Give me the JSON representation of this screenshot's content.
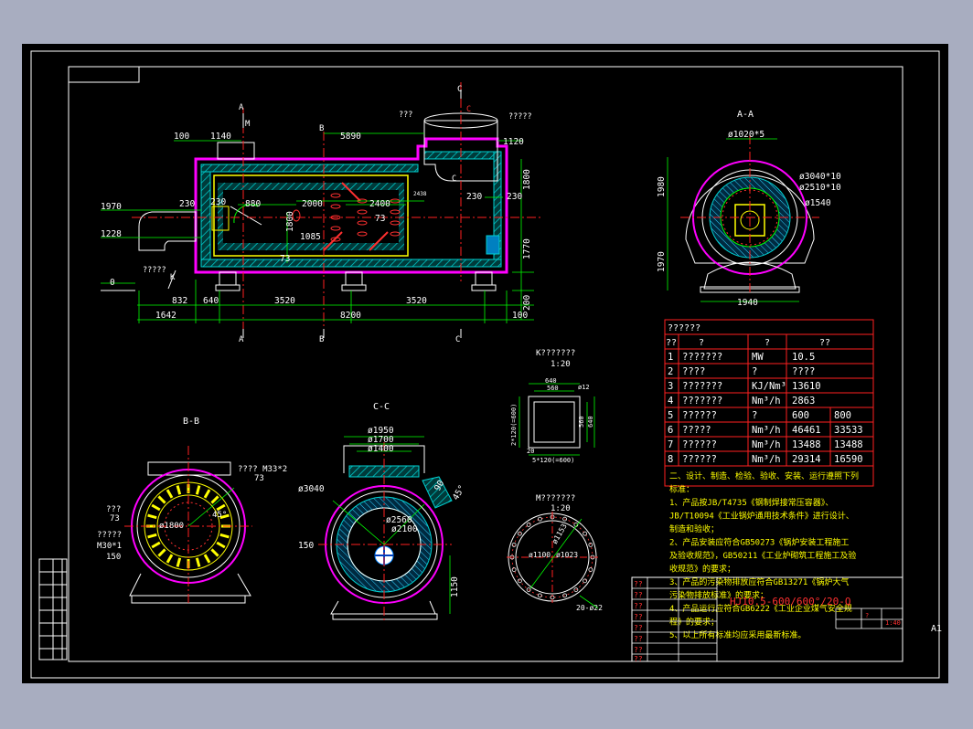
{
  "colors": {
    "background": "#000000",
    "frame": "#ffffff",
    "dimension": "#00ff00",
    "table": "#ff2020",
    "insulation": "#ff00ff",
    "hatch": "#00d0d0",
    "center": "#ff2020",
    "note_text": "#ffff00",
    "part_no": "#ff3030"
  },
  "sheet_label": "A1",
  "main_view": {
    "section_marks": [
      "A",
      "B",
      "C",
      "K",
      "M"
    ],
    "labels": {
      "top_q": "???",
      "top_qq": "?????",
      "top_c": "C",
      "left_q": "?????",
      "c_q": "????",
      "plate_q": "?",
      "hole_q": "?"
    },
    "dims": {
      "d100": "100",
      "d1140": "1140",
      "d5890": "5890",
      "d1120": "1120",
      "d230a": "230",
      "d230b": "230",
      "d230c": "230",
      "d880": "880",
      "d2000": "2000",
      "d2400": "2400",
      "d1800": "1800",
      "d1085": "1085",
      "d1800v": "1800",
      "d1770": "1770",
      "d1970": "1970",
      "d1228": "1228",
      "d0": "0",
      "d832": "832",
      "d640": "640",
      "d3520a": "3520",
      "d3520b": "3520",
      "d1642": "1642",
      "d8200": "8200",
      "d200": "200",
      "d100b": "100",
      "d2438": "2438",
      "d73a": "73",
      "d73b": "73"
    }
  },
  "view_aa": {
    "title": "A-A",
    "dims": {
      "dia1020": "ø1020*5",
      "dia3040": "ø3040*10",
      "dia2510": "ø2510*10",
      "dia1540": "ø1540",
      "h1980": "1980",
      "h1970": "1970",
      "w1940": "1940"
    }
  },
  "view_bb": {
    "title": "B-B",
    "labels": {
      "bolt": "???? M33*2",
      "q73": "73",
      "q3": "???",
      "q73b": "73",
      "q4": "?????",
      "m30": "M30*1",
      "d150": "150",
      "dia1800": "ø1800",
      "deg45": "45°"
    }
  },
  "view_cc": {
    "title": "C-C",
    "dims": {
      "dia1950": "ø1950",
      "dia1700": "ø1700",
      "dia1400": "ø1400",
      "dia3040": "ø3040",
      "dia2560": "ø2560",
      "dia2100": "ø2100",
      "d150": "150",
      "d1150": "1150",
      "deg45": "45°",
      "d90": "90"
    }
  },
  "view_k": {
    "title": "K???????",
    "scale": "1:20",
    "dims": {
      "w640": "640",
      "w560": "560",
      "d12": "ø12",
      "h560": "560",
      "h640": "640",
      "h2120": "2*120(=600)",
      "d20": "20",
      "b5120": "5*120(=600)"
    }
  },
  "view_m": {
    "title": "M???????",
    "scale": "1:20",
    "dims": {
      "dia1153": "ø1153",
      "dia1100": "ø1100",
      "dia1023": "ø1023",
      "holes": "20-ø22"
    }
  },
  "spec_table": {
    "title": "??????",
    "header": [
      "??",
      "?",
      "?",
      "??"
    ],
    "rows": [
      {
        "no": "1",
        "name": "???????",
        "unit": "MW",
        "v1": "10.5",
        "v2": ""
      },
      {
        "no": "2",
        "name": "????",
        "unit": "?",
        "v1": "????",
        "v2": ""
      },
      {
        "no": "3",
        "name": "???????",
        "unit": "KJ/Nm³",
        "v1": "13610",
        "v2": ""
      },
      {
        "no": "4",
        "name": "???????",
        "unit": "Nm³/h",
        "v1": "2863",
        "v2": ""
      },
      {
        "no": "5",
        "name": "??????",
        "unit": "?",
        "v1": "600",
        "v2": "800"
      },
      {
        "no": "6",
        "name": "?????",
        "unit": "Nm³/h",
        "v1": "46461",
        "v2": "33533"
      },
      {
        "no": "7",
        "name": "??????",
        "unit": "Nm³/h",
        "v1": "13488",
        "v2": "13488"
      },
      {
        "no": "8",
        "name": "??????",
        "unit": "Nm³/h",
        "v1": "29314",
        "v2": "16590"
      }
    ]
  },
  "notes": [
    "二、设计、制造、检验、验收、安装、运行遵照下列",
    "标准：",
    "1、产品按JB/T4735《钢制焊接常压容器》、",
    "JB/T10094《工业锅炉通用技术条件》进行设计、",
    "制造和验收；",
    "2、产品安装应符合GB50273《锅炉安装工程施工",
    "及验收规范》，GB50211《工业炉砌筑工程施工及验",
    "收规范》的要求；",
    "3、产品的污染物排放应符合GB13271《锅炉大气",
    "污染物排放标准》的要求；",
    "4、产品运行应符合GB6222《工业企业煤气安全规",
    "程》的要求；",
    "5、以上所有标准均应采用最新标准。"
  ],
  "title_block": {
    "part_no": "HJ10.5-600/600°/20-Q",
    "scale": "1:40",
    "sheet": "?",
    "cells": [
      "??",
      "??",
      "??",
      "??",
      "??",
      "??",
      "??",
      "??"
    ]
  }
}
